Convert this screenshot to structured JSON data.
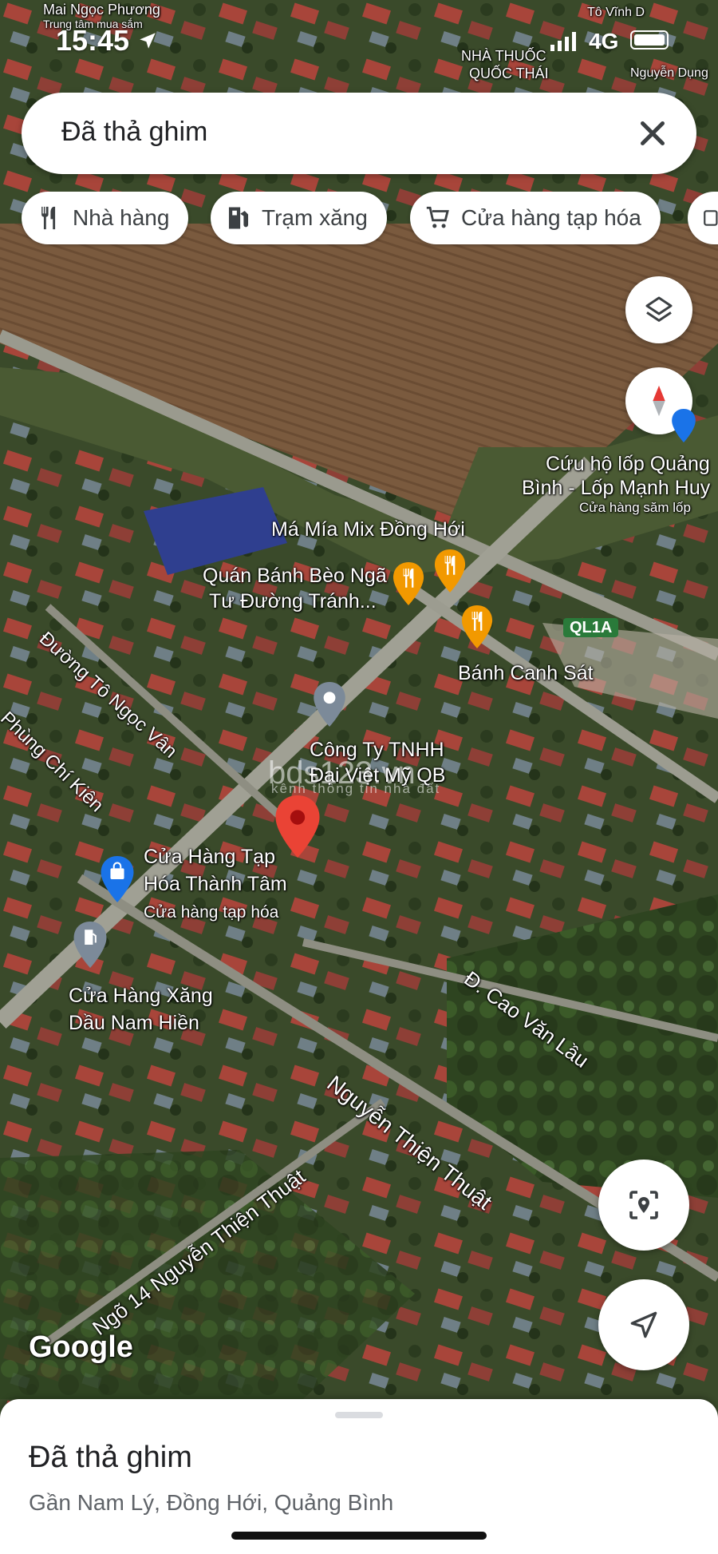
{
  "status_bar": {
    "time": "15:45",
    "network": "4G",
    "top_labels": [
      "Mai Ngọc Phương",
      "Trung tâm mua sắm",
      "Tô Vĩnh D",
      "NHÀ THUỐC",
      "QUỐC THÁI",
      "Nguyễn Dụng"
    ]
  },
  "search": {
    "query": "Đã thả ghim"
  },
  "chips": [
    {
      "label": "Nhà hàng",
      "icon": "restaurant-icon"
    },
    {
      "label": "Trạm xăng",
      "icon": "gas-station-icon"
    },
    {
      "label": "Cửa hàng tạp hóa",
      "icon": "shopping-cart-icon"
    }
  ],
  "map": {
    "pois": {
      "cuu_ho_1": "Cứu hộ lốp Quảng",
      "cuu_ho_2": "Bình - Lốp Mạnh Huy",
      "cuu_ho_sub": "Cửa hàng săm lốp",
      "ma_mia": "Má Mía Mix Đồng Hới",
      "quan_banh_1": "Quán Bánh Bèo Ngã",
      "quan_banh_2": "Tư Đường Tránh...",
      "ql1a": "QL1A",
      "banh_canh": "Bánh Canh Sát",
      "cong_ty_1": "Công Ty TNHH",
      "cong_ty_2": "Đại Việt Mỹ QB",
      "tap_hoa_1": "Cửa Hàng Tạp",
      "tap_hoa_2": "Hóa Thành Tâm",
      "tap_hoa_sub": "Cửa hàng tạp hóa",
      "xang_1": "Cửa Hàng Xăng",
      "xang_2": "Dầu Nam Hiền"
    },
    "roads": {
      "to_ngoc_van": "Đường Tô Ngọc Vân",
      "phung_chi_kien": "Phùng Chí Kiên",
      "cao_van_lau": "Đ. Cao Văn Lầu",
      "nguyen_thien_thuat": "Nguyễn Thiện Thuật",
      "ngo_14": "Ngõ 14 Nguyễn Thiện Thuật"
    },
    "watermark": "bds123.vn",
    "watermark_sub": "kênh thông tin nhà đất",
    "attribution": "Google"
  },
  "sheet": {
    "title": "Đã thả ghim",
    "address": "Gần Nam Lý, Đồng Hới, Quảng Bình"
  },
  "colors": {
    "pin_red": "#ea4335",
    "restaurant_orange": "#f29900",
    "shop_blue": "#1a73e8",
    "poi_grey": "#7c8a99",
    "compass_red": "#e53935"
  }
}
